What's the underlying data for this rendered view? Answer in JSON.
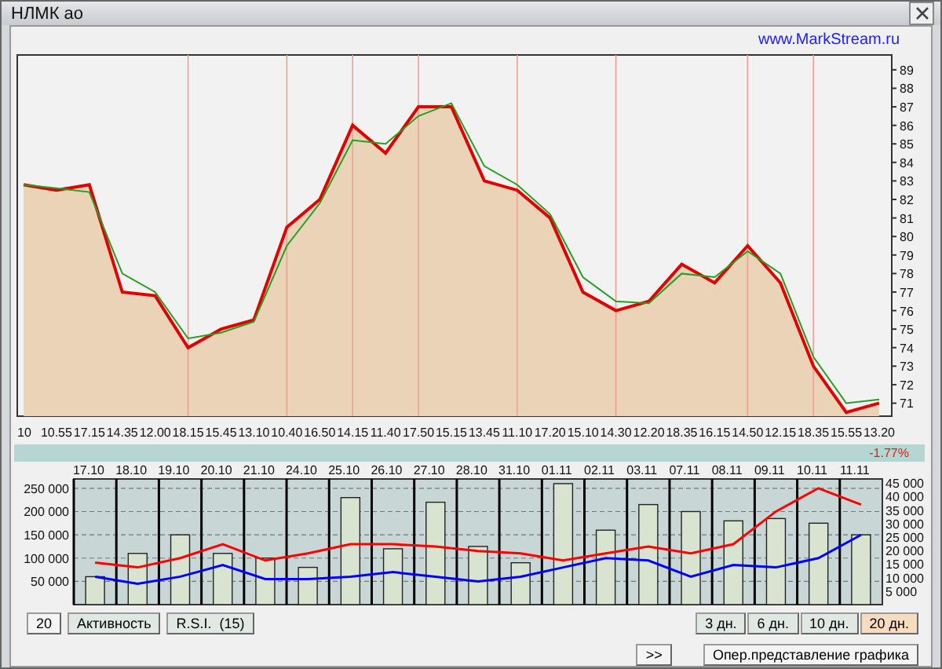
{
  "window": {
    "title": "НЛМК ао"
  },
  "site_link": "www.MarkStream.ru",
  "price_chart": {
    "chart_data": {
      "type": "area",
      "x": [
        "10",
        "10.55",
        "17.15",
        "14.35",
        "12.00",
        "18.15",
        "15.45",
        "13.10",
        "10.40",
        "16.50",
        "14.15",
        "11.40",
        "17.50",
        "15.15",
        "13.45",
        "11.10",
        "17.20",
        "15.10",
        "14.30",
        "12.20",
        "18.35",
        "16.15",
        "14.50",
        "12.15",
        "18.35",
        "15.55",
        "13.20"
      ],
      "series": [
        {
          "type": "area",
          "color": "#e00000",
          "values": [
            82.8,
            82.5,
            82.8,
            77,
            76.8,
            74,
            75,
            75.5,
            80.5,
            82,
            86,
            84.5,
            87,
            87,
            83,
            82.5,
            81,
            77,
            76,
            76.5,
            78.5,
            77.5,
            79.5,
            77.5,
            73,
            70.5,
            71
          ]
        },
        {
          "type": "line",
          "color": "#22a022",
          "values": [
            82.8,
            82.6,
            82.4,
            78,
            77,
            74.5,
            74.8,
            75.4,
            79.5,
            81.8,
            85.2,
            85,
            86.5,
            87.2,
            83.8,
            82.8,
            81.2,
            77.8,
            76.5,
            76.4,
            78,
            77.8,
            79.2,
            78,
            73.5,
            71,
            71.2
          ]
        }
      ],
      "ylim": [
        70.3,
        89.8
      ],
      "grid": true,
      "yticks": [
        71,
        72,
        73,
        74,
        75,
        76,
        77,
        78,
        79,
        80,
        81,
        82,
        83,
        84,
        85,
        86,
        87,
        88,
        89
      ]
    }
  },
  "change": "-1.77%",
  "volume_chart": {
    "chart_data": {
      "type": "bar",
      "categories": [
        "17.10",
        "18.10",
        "19.10",
        "20.10",
        "21.10",
        "24.10",
        "25.10",
        "26.10",
        "27.10",
        "28.10",
        "31.10",
        "01.11",
        "02.11",
        "03.11",
        "07.11",
        "08.11",
        "09.11",
        "10.11",
        "11.11"
      ],
      "grid": true,
      "series": [
        {
          "type": "bar",
          "color": "#d8e4d0",
          "values": [
            60000,
            110000,
            150000,
            110000,
            100000,
            80000,
            230000,
            120000,
            220000,
            125000,
            90000,
            260000,
            160000,
            215000,
            200000,
            180000,
            185000,
            175000,
            150000
          ]
        },
        {
          "type": "line",
          "color": "#ff0000",
          "values": [
            90000,
            80000,
            100000,
            130000,
            95000,
            110000,
            130000,
            130000,
            125000,
            115000,
            110000,
            95000,
            110000,
            125000,
            110000,
            130000,
            200000,
            250000,
            215000
          ]
        },
        {
          "type": "line",
          "color": "#0000ff",
          "values": [
            60000,
            45000,
            60000,
            85000,
            55000,
            55000,
            60000,
            70000,
            60000,
            50000,
            60000,
            80000,
            100000,
            95000,
            60000,
            85000,
            80000,
            100000,
            150000
          ]
        }
      ],
      "ylim": [
        0,
        270000
      ],
      "yticks": [
        {
          "value": 50000,
          "label": "50 000"
        },
        {
          "value": 100000,
          "label": "100 000"
        },
        {
          "value": 150000,
          "label": "150 000"
        },
        {
          "value": 200000,
          "label": "200 000"
        },
        {
          "value": 250000,
          "label": "250 000"
        }
      ]
    },
    "right_ticks": [
      "45 000",
      "40 000",
      "35 000",
      "30 000",
      "25 000",
      "20 000",
      "15 000",
      "10 000",
      "5 000"
    ]
  },
  "left_buttons": [
    "20",
    "Активность",
    "R.S.I.  (15)"
  ],
  "period_buttons": [
    {
      "label": "3 дн.",
      "selected": false
    },
    {
      "label": "6 дн.",
      "selected": false
    },
    {
      "label": "10 дн.",
      "selected": false
    },
    {
      "label": "20 дн.",
      "selected": true
    }
  ],
  "more_button": ">>",
  "mode_button": "Опер.представление графика"
}
